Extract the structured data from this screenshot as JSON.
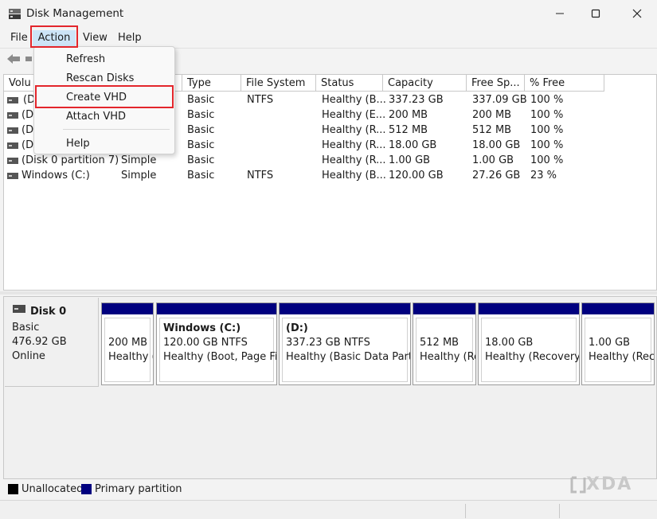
{
  "window": {
    "title": "Disk Management"
  },
  "menu": {
    "file": "File",
    "action": "Action",
    "view": "View",
    "help": "Help"
  },
  "dropdown": {
    "refresh": "Refresh",
    "rescan": "Rescan Disks",
    "create_vhd": "Create VHD",
    "attach_vhd": "Attach VHD",
    "help": "Help"
  },
  "columns": {
    "volume": "Volu",
    "layout": "",
    "type": "Type",
    "file_system": "File System",
    "status": "Status",
    "capacity": "Capacity",
    "free_space": "Free Sp...",
    "pct_free": "% Free"
  },
  "volumes": [
    {
      "volume": "(D",
      "layout": "",
      "type": "Basic",
      "fs": "NTFS",
      "status": "Healthy (B...",
      "capacity": "337.23 GB",
      "free": "337.09 GB",
      "pct": "100 %"
    },
    {
      "volume": "(Di",
      "layout": "",
      "type": "Basic",
      "fs": "",
      "status": "Healthy (E...",
      "capacity": "200 MB",
      "free": "200 MB",
      "pct": "100 %"
    },
    {
      "volume": "(Di",
      "layout": "",
      "type": "Basic",
      "fs": "",
      "status": "Healthy (R...",
      "capacity": "512 MB",
      "free": "512 MB",
      "pct": "100 %"
    },
    {
      "volume": "(Di",
      "layout": "",
      "type": "Basic",
      "fs": "",
      "status": "Healthy (R...",
      "capacity": "18.00 GB",
      "free": "18.00 GB",
      "pct": "100 %"
    },
    {
      "volume": "(Disk 0 partition 7)",
      "layout": "Simple",
      "type": "Basic",
      "fs": "",
      "status": "Healthy (R...",
      "capacity": "1.00 GB",
      "free": "1.00 GB",
      "pct": "100 %"
    },
    {
      "volume": "Windows (C:)",
      "layout": "Simple",
      "type": "Basic",
      "fs": "NTFS",
      "status": "Healthy (B...",
      "capacity": "120.00 GB",
      "free": "27.26 GB",
      "pct": "23 %"
    }
  ],
  "disk": {
    "name": "Disk 0",
    "type": "Basic",
    "size": "476.92 GB",
    "state": "Online"
  },
  "partitions": [
    {
      "title": "",
      "size": "200 MB",
      "status": "Healthy ("
    },
    {
      "title": "Windows  (C:)",
      "size": "120.00 GB NTFS",
      "status": "Healthy (Boot, Page File"
    },
    {
      "title": "(D:)",
      "size": "337.23 GB NTFS",
      "status": "Healthy (Basic Data Partiti"
    },
    {
      "title": "",
      "size": "512 MB",
      "status": "Healthy (Re"
    },
    {
      "title": "",
      "size": "18.00 GB",
      "status": "Healthy (Recovery I"
    },
    {
      "title": "",
      "size": "1.00 GB",
      "status": "Healthy (Reco"
    }
  ],
  "legend": {
    "unallocated": "Unallocated",
    "primary": "Primary partition"
  },
  "colors": {
    "primary_partition": "#00007f",
    "unallocated": "#000000",
    "highlight": "#e3262c",
    "menu_active": "#cce4f7"
  },
  "watermark": {
    "text": "XDA"
  }
}
